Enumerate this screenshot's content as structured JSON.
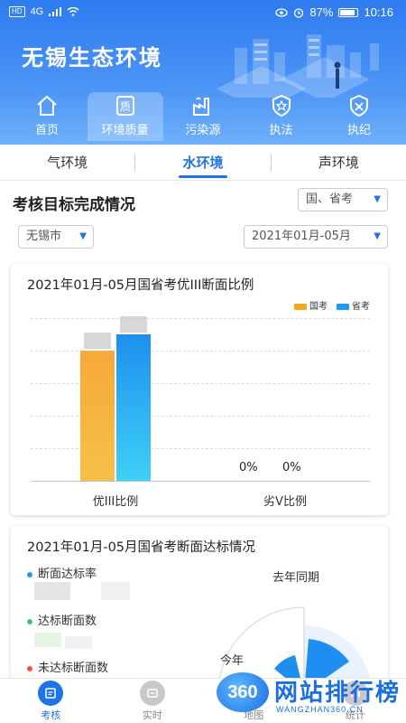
{
  "status_bar": {
    "network": "HD",
    "signal": "4G",
    "battery": "87%",
    "time": "10:16"
  },
  "app_title": "无锡生态环境",
  "nav": [
    {
      "label": "首页",
      "icon": "home-icon"
    },
    {
      "label": "环境质量",
      "icon": "quality-icon",
      "active": true
    },
    {
      "label": "污染源",
      "icon": "factory-icon"
    },
    {
      "label": "执法",
      "icon": "shield-star-icon"
    },
    {
      "label": "执纪",
      "icon": "discipline-icon"
    }
  ],
  "subtabs": [
    {
      "label": "气环境"
    },
    {
      "label": "水环境",
      "active": true
    },
    {
      "label": "声环境"
    }
  ],
  "section": {
    "title": "考核目标完成情况",
    "filter_level": "国、省考",
    "filter_city": "无锡市",
    "filter_period": "2021年01月-05月"
  },
  "card1": {
    "title": "2021年01月-05月国省考优III断面比例",
    "legend": [
      "国考",
      "省考"
    ]
  },
  "chart_data": {
    "type": "bar",
    "title": "2021年01月-05月国省考优III断面比例",
    "categories": [
      "优III比例",
      "劣Ⅴ比例"
    ],
    "series": [
      {
        "name": "国考",
        "values": [
          80,
          0
        ],
        "color": "#f5a623"
      },
      {
        "name": "省考",
        "values": [
          90,
          0
        ],
        "color": "#1e9bf0"
      }
    ],
    "data_labels": [
      "0%",
      "0%"
    ],
    "ylim": [
      0,
      100
    ],
    "grid": true,
    "legend": "top-right"
  },
  "card2": {
    "title": "2021年01月-05月国省考断面达标情况",
    "items": [
      {
        "label": "断面达标率",
        "color": "#1e9bf0"
      },
      {
        "label": "达标断面数",
        "color": "#3cc76a"
      },
      {
        "label": "未达标断面数",
        "color": "#f0533a"
      }
    ],
    "ring_label_last_year": "去年同期",
    "ring_label_this_year": "今年"
  },
  "bottom_tabs": [
    {
      "label": "考核",
      "active": true
    },
    {
      "label": "实时"
    },
    {
      "label": "地图"
    },
    {
      "label": "统计"
    }
  ],
  "watermark": {
    "logo": "360",
    "text": "网站排行榜",
    "url": "WANGZHAN360.CN"
  }
}
